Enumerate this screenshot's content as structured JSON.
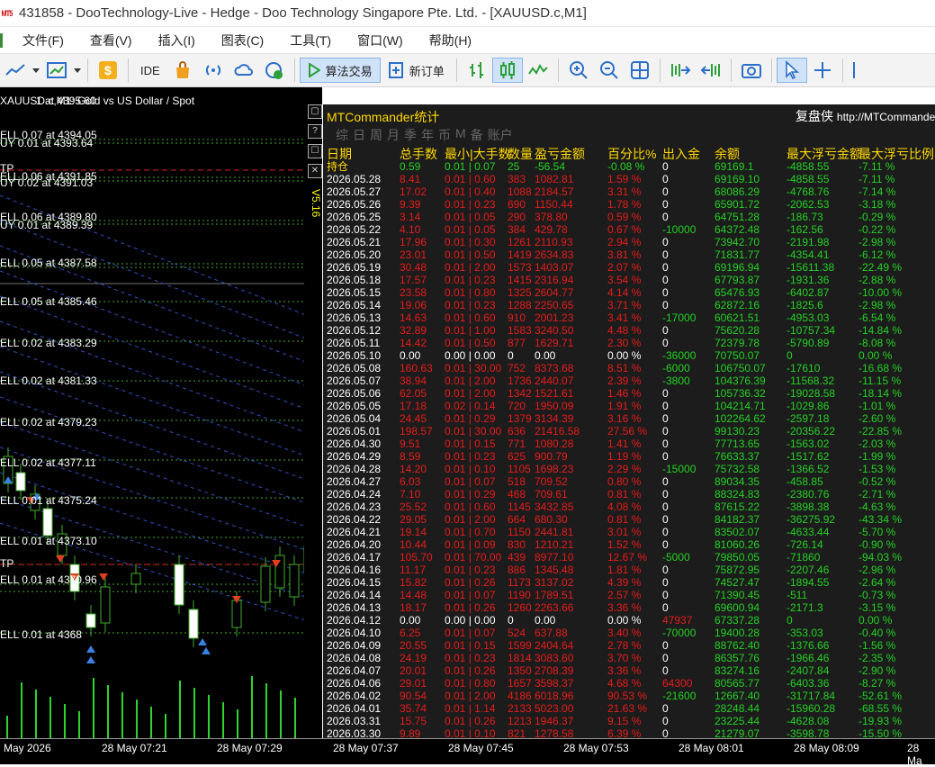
{
  "title": "431858 - DooTechnology-Live - Hedge - Doo Technology Singapore Pte. Ltd. - [XAUUSD.c,M1]",
  "menu": [
    "文件(F)",
    "查看(V)",
    "插入(I)",
    "图表(C)",
    "工具(T)",
    "窗口(W)",
    "帮助(H)"
  ],
  "toolbar": {
    "ide": "IDE",
    "algo": "算法交易",
    "new_order": "新订单"
  },
  "chart": {
    "header": "XAUUSD.c,M1:  Gold vs US Dollar / Spot",
    "header_overlay": "1 at 4395.60",
    "labels": [
      "ELL 0.07 at 4394.05",
      "UY 0.01 at 4393.64",
      "TP",
      "ELL 0.06 at 4391.85",
      "UY 0.02 at 4391.03",
      "ELL 0.06 at 4389.80",
      "UY 0.01 at 4389.39",
      "ELL 0.05 at 4387.58",
      "ELL 0.05 at 4385.46",
      "ELL 0.02 at 4383.29",
      "ELL 0.02 at 4381.33",
      "ELL 0.02 at 4379.23",
      "ELL 0.02 at 4377.11",
      "ELL 0.01 at 4375.24",
      "ELL 0.01 at 4373.10",
      "TP",
      "ELL 0.01 at 4370.96",
      "ELL 0.01 at 4368"
    ],
    "vertical_label": "V5.16",
    "time_axis": [
      "May 2026",
      "28 May 07:21",
      "28 May 07:29",
      "28 May 07:37",
      "28 May 07:45",
      "28 May 07:53",
      "28 May 08:01",
      "28 May 08:09",
      "28 Ma"
    ]
  },
  "panel": {
    "title": "MTCommander统计",
    "replay": "复盘侠",
    "url": "http://MTCommander",
    "tabs": [
      "综",
      "日",
      "周",
      "月",
      "季",
      "年",
      "币",
      "M",
      "备",
      "账户"
    ],
    "columns": [
      "日期",
      "总手数",
      "最小|大手数",
      "数量",
      "盈亏金额",
      "百分比%",
      "出入金",
      "余额",
      "最大浮亏金额",
      "最大浮亏比例"
    ],
    "holding": [
      "持仓",
      "0.59",
      "0.01 | 0.07",
      "25",
      "-56.54",
      "-0.08 %",
      "0",
      "69169.1",
      "-4858.55",
      "-7.11 %"
    ],
    "rows": [
      [
        "2026.05.28",
        "8.41",
        "0.01 | 0.60",
        "383",
        "1082.81",
        "1.59 %",
        "0",
        "69169.10",
        "-4858.55",
        "-7.11 %"
      ],
      [
        "2026.05.27",
        "17.02",
        "0.01 | 0.40",
        "1088",
        "2184.57",
        "3.31 %",
        "0",
        "68086.29",
        "-4768.76",
        "-7.14 %"
      ],
      [
        "2026.05.26",
        "9.39",
        "0.01 | 0.23",
        "690",
        "1150.44",
        "1.78 %",
        "0",
        "65901.72",
        "-2062.53",
        "-3.18 %"
      ],
      [
        "2026.05.25",
        "3.14",
        "0.01 | 0.05",
        "290",
        "378.80",
        "0.59 %",
        "0",
        "64751.28",
        "-186.73",
        "-0.29 %"
      ],
      [
        "2026.05.22",
        "4.10",
        "0.01 | 0.05",
        "384",
        "429.78",
        "0.67 %",
        "-10000",
        "64372.48",
        "-162.56",
        "-0.22 %"
      ],
      [
        "2026.05.21",
        "17.96",
        "0.01 | 0.30",
        "1261",
        "2110.93",
        "2.94 %",
        "0",
        "73942.70",
        "-2191.98",
        "-2.98 %"
      ],
      [
        "2026.05.20",
        "23.01",
        "0.01 | 0.50",
        "1419",
        "2634.83",
        "3.81 %",
        "0",
        "71831.77",
        "-4354.41",
        "-6.12 %"
      ],
      [
        "2026.05.19",
        "30.48",
        "0.01 | 2.00",
        "1573",
        "1403.07",
        "2.07 %",
        "0",
        "69196.94",
        "-15611.38",
        "-22.49 %"
      ],
      [
        "2026.05.18",
        "17.57",
        "0.01 | 0.23",
        "1415",
        "2316.94",
        "3.54 %",
        "0",
        "67793.87",
        "-1931.36",
        "-2.88 %"
      ],
      [
        "2026.05.15",
        "23.58",
        "0.01 | 0.80",
        "1325",
        "2604.77",
        "4.14 %",
        "0",
        "65476.93",
        "-6402.87",
        "-10.00 %"
      ],
      [
        "2026.05.14",
        "19.06",
        "0.01 | 0.23",
        "1288",
        "2250.65",
        "3.71 %",
        "0",
        "62872.16",
        "-1825.6",
        "-2.98 %"
      ],
      [
        "2026.05.13",
        "14.63",
        "0.01 | 0.60",
        "910",
        "2001.23",
        "3.41 %",
        "-17000",
        "60621.51",
        "-4953.03",
        "-6.54 %"
      ],
      [
        "2026.05.12",
        "32.89",
        "0.01 | 1.00",
        "1583",
        "3240.50",
        "4.48 %",
        "0",
        "75620.28",
        "-10757.34",
        "-14.84 %"
      ],
      [
        "2026.05.11",
        "14.42",
        "0.01 | 0.50",
        "877",
        "1629.71",
        "2.30 %",
        "0",
        "72379.78",
        "-5790.89",
        "-8.08 %"
      ],
      [
        "2026.05.10",
        "0.00",
        "0.00 | 0.00",
        "0",
        "0.00",
        "0.00 %",
        "-36000",
        "70750.07",
        "0",
        "0.00 %"
      ],
      [
        "2026.05.08",
        "160.63",
        "0.01 | 30.00",
        "752",
        "8373.68",
        "8.51 %",
        "-6000",
        "106750.07",
        "-17610",
        "-16.68 %"
      ],
      [
        "2026.05.07",
        "38.94",
        "0.01 | 2.00",
        "1736",
        "2440.07",
        "2.39 %",
        "-3800",
        "104376.39",
        "-11568.32",
        "-11.15 %"
      ],
      [
        "2026.05.06",
        "62.05",
        "0.01 | 2.00",
        "1342",
        "1521.61",
        "1.46 %",
        "0",
        "105736.32",
        "-19028.58",
        "-18.14 %"
      ],
      [
        "2026.05.05",
        "17.18",
        "0.02 | 0.14",
        "720",
        "1950.09",
        "1.91 %",
        "0",
        "104214.71",
        "-1029.86",
        "-1.01 %"
      ],
      [
        "2026.05.04",
        "24.45",
        "0.01 | 0.29",
        "1379",
        "3134.39",
        "3.16 %",
        "0",
        "102264.62",
        "-2597.18",
        "-2.60 %"
      ],
      [
        "2026.05.01",
        "198.57",
        "0.01 | 30.00",
        "636",
        "21416.58",
        "27.56 %",
        "0",
        "99130.23",
        "-20356.22",
        "-22.85 %"
      ],
      [
        "2026.04.30",
        "9.51",
        "0.01 | 0.15",
        "771",
        "1080.28",
        "1.41 %",
        "0",
        "77713.65",
        "-1563.02",
        "-2.03 %"
      ],
      [
        "2026.04.29",
        "8.59",
        "0.01 | 0.23",
        "625",
        "900.79",
        "1.19 %",
        "0",
        "76633.37",
        "-1517.62",
        "-1.99 %"
      ],
      [
        "2026.04.28",
        "14.20",
        "0.01 | 0.10",
        "1105",
        "1698.23",
        "2.29 %",
        "-15000",
        "75732.58",
        "-1366.52",
        "-1.53 %"
      ],
      [
        "2026.04.27",
        "6.03",
        "0.01 | 0.07",
        "518",
        "709.52",
        "0.80 %",
        "0",
        "89034.35",
        "-458.85",
        "-0.52 %"
      ],
      [
        "2026.04.24",
        "7.10",
        "0.01 | 0.29",
        "468",
        "709.61",
        "0.81 %",
        "0",
        "88324.83",
        "-2380.76",
        "-2.71 %"
      ],
      [
        "2026.04.23",
        "25.52",
        "0.01 | 0.60",
        "1145",
        "3432.85",
        "4.08 %",
        "0",
        "87615.22",
        "-3898.38",
        "-4.63 %"
      ],
      [
        "2026.04.22",
        "29.05",
        "0.01 | 2.00",
        "664",
        "680.30",
        "0.81 %",
        "0",
        "84182.37",
        "-36275.92",
        "-43.34 %"
      ],
      [
        "2026.04.21",
        "19.14",
        "0.01 | 0.70",
        "1150",
        "2441.81",
        "3.01 %",
        "0",
        "83502.07",
        "-4633.44",
        "-5.70 %"
      ],
      [
        "2026.04.20",
        "10.44",
        "0.01 | 0.09",
        "830",
        "1210.21",
        "1.52 %",
        "0",
        "81060.26",
        "-726.14",
        "-0.90 %"
      ],
      [
        "2026.04.17",
        "105.70",
        "0.01 | 70.00",
        "439",
        "8977.10",
        "12.67 %",
        "-5000",
        "79850.05",
        "-71860",
        "-94.03 %"
      ],
      [
        "2026.04.16",
        "11.17",
        "0.01 | 0.23",
        "886",
        "1345.48",
        "1.81 %",
        "0",
        "75872.95",
        "-2207.46",
        "-2.96 %"
      ],
      [
        "2026.04.15",
        "15.82",
        "0.01 | 0.26",
        "1173",
        "3137.02",
        "4.39 %",
        "0",
        "74527.47",
        "-1894.55",
        "-2.64 %"
      ],
      [
        "2026.04.14",
        "14.48",
        "0.01 | 0.07",
        "1190",
        "1789.51",
        "2.57 %",
        "0",
        "71390.45",
        "-511",
        "-0.73 %"
      ],
      [
        "2026.04.13",
        "18.17",
        "0.01 | 0.26",
        "1260",
        "2263.66",
        "3.36 %",
        "0",
        "69600.94",
        "-2171.3",
        "-3.15 %"
      ],
      [
        "2026.04.12",
        "0.00",
        "0.00 | 0.00",
        "0",
        "0.00",
        "0.00 %",
        "47937",
        "67337.28",
        "0",
        "0.00 %"
      ],
      [
        "2026.04.10",
        "6.25",
        "0.01 | 0.07",
        "524",
        "637.88",
        "3.40 %",
        "-70000",
        "19400.28",
        "-353.03",
        "-0.40 %"
      ],
      [
        "2026.04.09",
        "20.55",
        "0.01 | 0.15",
        "1599",
        "2404.64",
        "2.78 %",
        "0",
        "88762.40",
        "-1376.66",
        "-1.56 %"
      ],
      [
        "2026.04.08",
        "24.19",
        "0.01 | 0.23",
        "1814",
        "3083.60",
        "3.70 %",
        "0",
        "86357.76",
        "-1966.46",
        "-2.35 %"
      ],
      [
        "2026.04.07",
        "20.01",
        "0.01 | 0.26",
        "1350",
        "2708.39",
        "3.36 %",
        "0",
        "83274.16",
        "-2407.84",
        "-2.90 %"
      ],
      [
        "2026.04.06",
        "29.01",
        "0.01 | 0.80",
        "1657",
        "3598.37",
        "4.68 %",
        "64300",
        "80565.77",
        "-6403.36",
        "-8.27 %"
      ],
      [
        "2026.04.02",
        "90.54",
        "0.01 | 2.00",
        "4186",
        "6018.96",
        "90.53 %",
        "-21600",
        "12667.40",
        "-31717.84",
        "-52.61 %"
      ],
      [
        "2026.04.01",
        "35.74",
        "0.01 | 1.14",
        "2133",
        "5023.00",
        "21.63 %",
        "0",
        "28248.44",
        "-15960.28",
        "-68.55 %"
      ],
      [
        "2026.03.31",
        "15.75",
        "0.01 | 0.26",
        "1213",
        "1946.37",
        "9.15 %",
        "0",
        "23225.44",
        "-4628.08",
        "-19.93 %"
      ],
      [
        "2026.03.30",
        "9.89",
        "0.01 | 0.10",
        "821",
        "1278.58",
        "6.39 %",
        "0",
        "21279.07",
        "-3598.78",
        "-15.50 %"
      ]
    ],
    "colors": {
      "header": "#ffd800",
      "date": "#ffffff",
      "profit": "#e81b1b",
      "loss": "#24d024",
      "neutral": "#ffffff"
    }
  }
}
